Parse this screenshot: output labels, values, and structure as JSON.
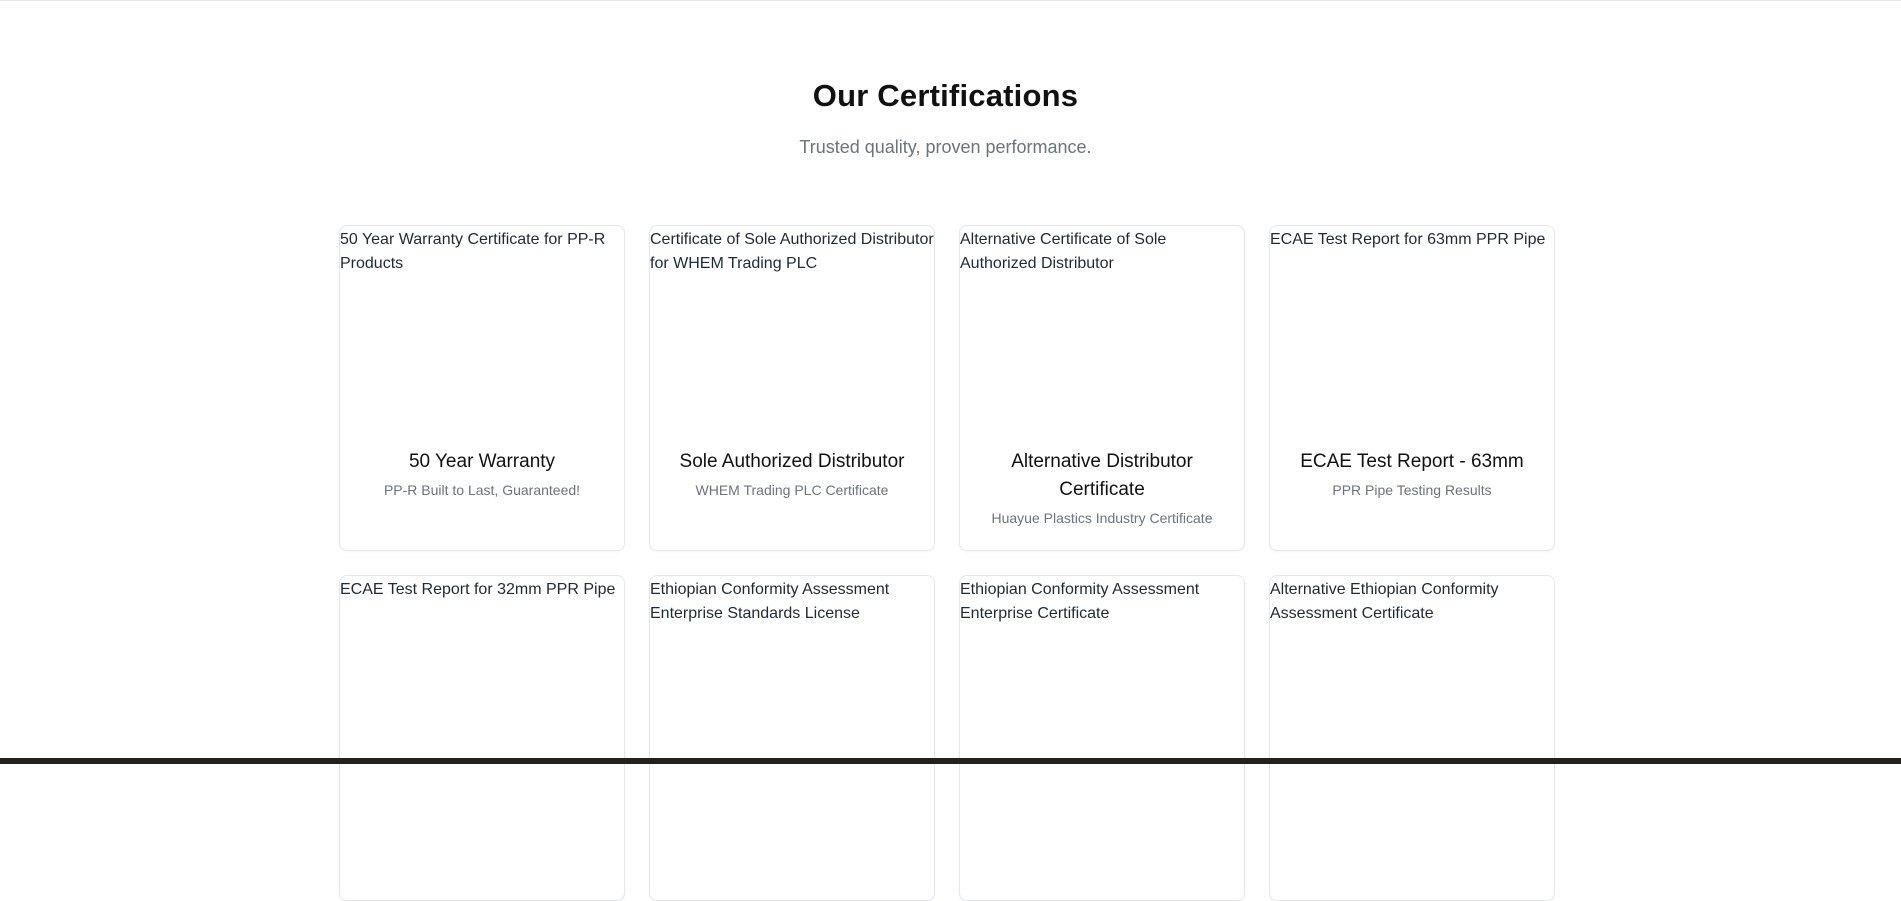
{
  "section": {
    "title": "Our Certifications",
    "subtitle": "Trusted quality, proven performance."
  },
  "cards": [
    {
      "alt": "50 Year Warranty Certificate for PP-R Products",
      "title": "50 Year Warranty",
      "subtitle": "PP-R Built to Last, Guaranteed!"
    },
    {
      "alt": "Certificate of Sole Authorized Distributor for WHEM Trading PLC",
      "title": "Sole Authorized Distributor",
      "subtitle": "WHEM Trading PLC Certificate"
    },
    {
      "alt": "Alternative Certificate of Sole Authorized Distributor",
      "title": "Alternative Distributor Certificate",
      "subtitle": "Huayue Plastics Industry Certificate"
    },
    {
      "alt": "ECAE Test Report for 63mm PPR Pipe",
      "title": "ECAE Test Report - 63mm",
      "subtitle": "PPR Pipe Testing Results"
    },
    {
      "alt": "ECAE Test Report for 32mm PPR Pipe",
      "title": "",
      "subtitle": ""
    },
    {
      "alt": "Ethiopian Conformity Assessment Enterprise Standards License",
      "title": "",
      "subtitle": ""
    },
    {
      "alt": "Ethiopian Conformity Assessment Enterprise Certificate",
      "title": "",
      "subtitle": ""
    },
    {
      "alt": "Alternative Ethiopian Conformity Assessment Certificate",
      "title": "",
      "subtitle": ""
    }
  ]
}
